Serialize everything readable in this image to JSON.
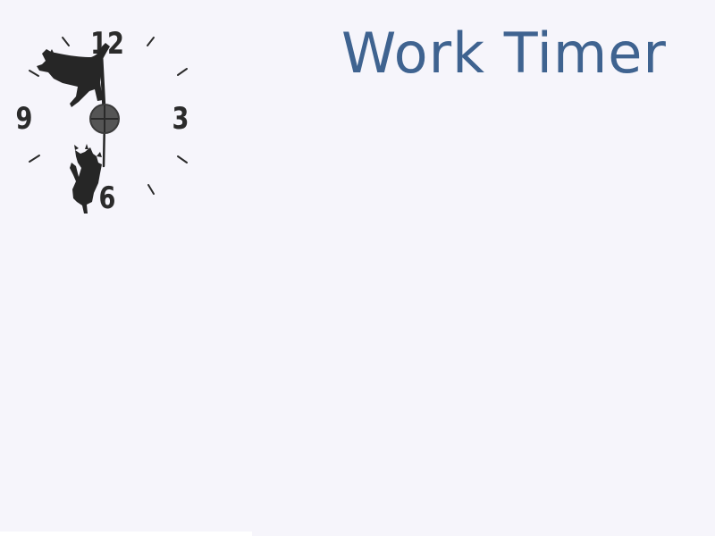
{
  "app": {
    "title": "Work Timer"
  },
  "clock": {
    "numerals": {
      "twelve": "12",
      "three": "3",
      "six": "6",
      "nine": "9"
    },
    "icons": {
      "top_decoration": "cat-silhouette-icon",
      "bottom_decoration": "cat-silhouette-icon",
      "hub": "clock-hub-icon"
    }
  },
  "colors": {
    "background": "#f6f5fb",
    "title": "#3f6390",
    "clock_ink": "#2b2b2b"
  }
}
